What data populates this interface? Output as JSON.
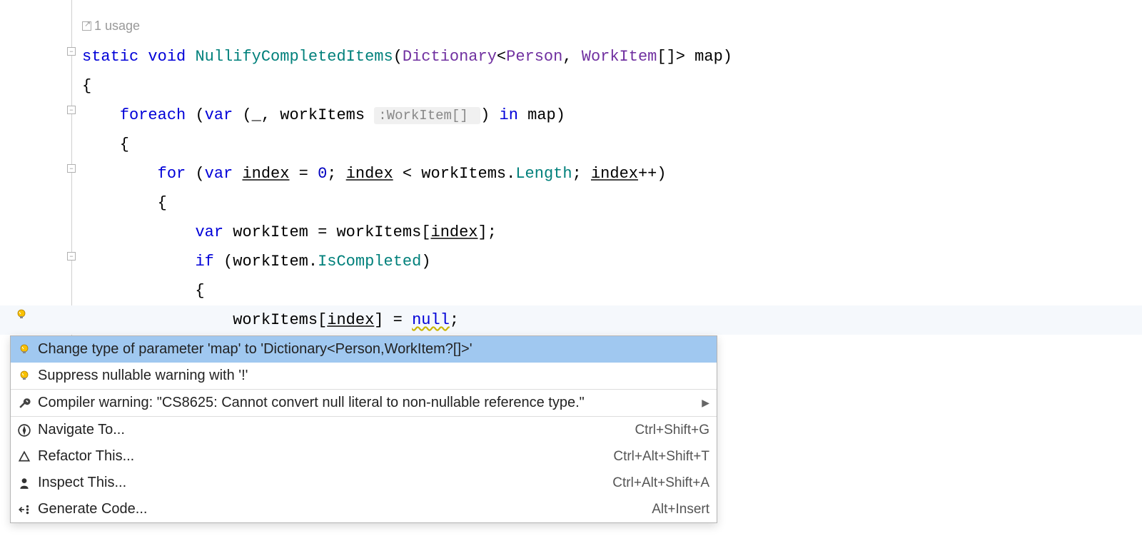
{
  "hint": {
    "usages_text": "1 usage"
  },
  "code": {
    "lines": [
      {
        "segments": [
          {
            "t": "static ",
            "c": "kw"
          },
          {
            "t": "void ",
            "c": "kw"
          },
          {
            "t": "NullifyCompletedItems",
            "c": "method"
          },
          {
            "t": "("
          },
          {
            "t": "Dictionary",
            "c": "type"
          },
          {
            "t": "<"
          },
          {
            "t": "Person",
            "c": "type"
          },
          {
            "t": ", "
          },
          {
            "t": "WorkItem",
            "c": "type"
          },
          {
            "t": "[]> map)"
          }
        ]
      },
      {
        "segments": [
          {
            "t": "{"
          }
        ]
      },
      {
        "segments": [
          {
            "t": "    "
          },
          {
            "t": "foreach ",
            "c": "kw"
          },
          {
            "t": "("
          },
          {
            "t": "var ",
            "c": "kw"
          },
          {
            "t": "(_, workItems "
          },
          {
            "t": ":WorkItem[] ",
            "c": "param-hint"
          },
          {
            "t": ") "
          },
          {
            "t": "in ",
            "c": "kw"
          },
          {
            "t": "map)"
          }
        ]
      },
      {
        "segments": [
          {
            "t": "    {"
          }
        ]
      },
      {
        "segments": [
          {
            "t": "        "
          },
          {
            "t": "for ",
            "c": "kw"
          },
          {
            "t": "("
          },
          {
            "t": "var ",
            "c": "kw"
          },
          {
            "t": "index",
            "c": "underline"
          },
          {
            "t": " = "
          },
          {
            "t": "0",
            "c": "num"
          },
          {
            "t": "; "
          },
          {
            "t": "index",
            "c": "underline"
          },
          {
            "t": " < workItems."
          },
          {
            "t": "Length",
            "c": "prop"
          },
          {
            "t": "; "
          },
          {
            "t": "index",
            "c": "underline"
          },
          {
            "t": "++)"
          }
        ]
      },
      {
        "segments": [
          {
            "t": "        {"
          }
        ]
      },
      {
        "segments": [
          {
            "t": "            "
          },
          {
            "t": "var ",
            "c": "kw"
          },
          {
            "t": "workItem = workItems["
          },
          {
            "t": "index",
            "c": "underline"
          },
          {
            "t": "];"
          }
        ]
      },
      {
        "segments": [
          {
            "t": "            "
          },
          {
            "t": "if ",
            "c": "kw"
          },
          {
            "t": "(workItem."
          },
          {
            "t": "IsCompleted",
            "c": "prop"
          },
          {
            "t": ")"
          }
        ]
      },
      {
        "segments": [
          {
            "t": "            {"
          }
        ]
      },
      {
        "segments": [
          {
            "t": "                workItems["
          },
          {
            "t": "index",
            "c": "underline"
          },
          {
            "t": "] = "
          },
          {
            "t": "null",
            "c": "kw null-warn"
          },
          {
            "t": ";"
          }
        ],
        "highlighted": true
      }
    ]
  },
  "popup": {
    "items": [
      {
        "icon": "bulb",
        "label": "Change type of parameter 'map' to 'Dictionary<Person,WorkItem?[]>'",
        "selected": true,
        "interactable": true
      },
      {
        "icon": "bulb",
        "label": "Suppress nullable warning with '!'",
        "interactable": true
      },
      {
        "icon": "wrench",
        "label": "Compiler warning: \"CS8625: Cannot convert null literal to non-nullable reference type.\"",
        "arrow": true,
        "separator": true,
        "interactable": true
      },
      {
        "icon": "compass",
        "label": "Navigate To...",
        "shortcut": "Ctrl+Shift+G",
        "separator": true,
        "interactable": true
      },
      {
        "icon": "triangle",
        "label": "Refactor This...",
        "shortcut": "Ctrl+Alt+Shift+T",
        "interactable": true
      },
      {
        "icon": "person",
        "label": "Inspect This...",
        "shortcut": "Ctrl+Alt+Shift+A",
        "interactable": true
      },
      {
        "icon": "gen",
        "label": "Generate Code...",
        "shortcut": "Alt+Insert",
        "interactable": true
      }
    ]
  }
}
